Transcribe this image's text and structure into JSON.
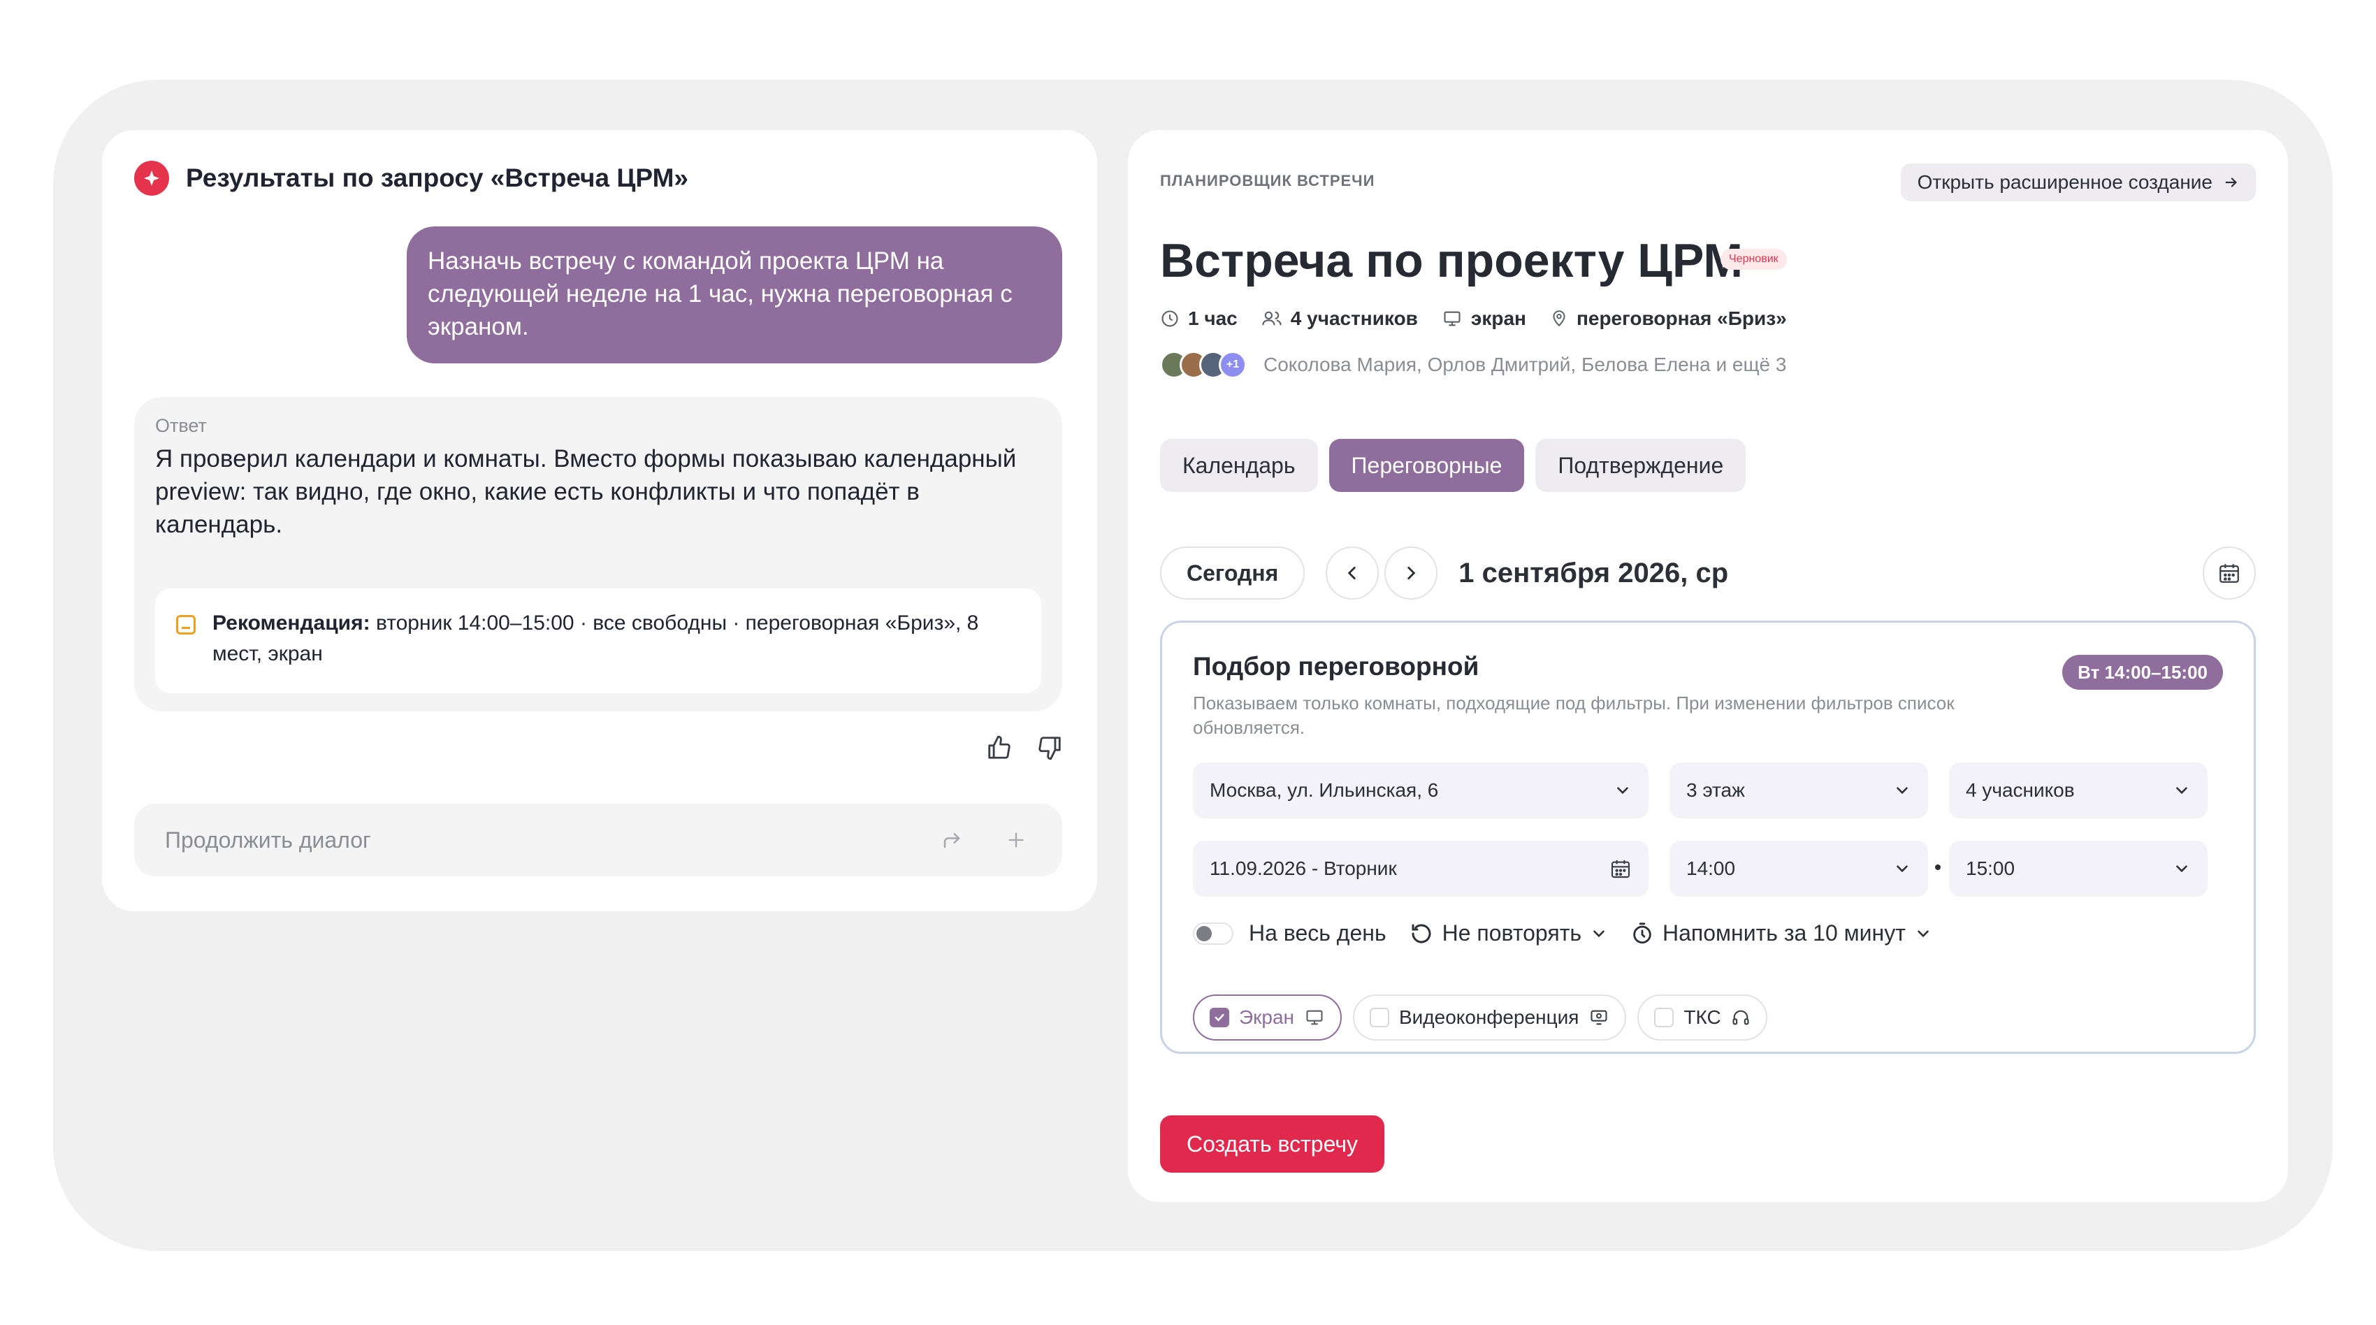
{
  "chat": {
    "title": "Результаты по запросу «Встреча ЦРМ»",
    "user_message": "Назначь встречу с командой проекта ЦРМ на следующей неделе на 1 час, нужна переговорная с экраном.",
    "answer_label": "Ответ",
    "answer_text": "Я проверил календари и комнаты. Вместо формы показываю календарный preview: так видно, где окно, какие есть конфликты и что попадёт в календарь.",
    "recommendation_label": "Рекомендация:",
    "recommendation_text": " вторник 14:00–15:00 · все свободны · переговорная «Бриз», 8 мест, экран",
    "continue_placeholder": "Продолжить диалог"
  },
  "planner": {
    "section_label": "ПЛАНИРОВЩИК ВСТРЕЧИ",
    "advanced_button": "Открыть расширенное создание",
    "title": "Встреча по проекту ЦРМ",
    "draft_badge": "Черновик",
    "meta": {
      "duration": "1 час",
      "participants_count": "4 участников",
      "equipment": "экран",
      "room": "переговорная «Бриз»"
    },
    "avatar_more": "+1",
    "participants_text": "Соколова Мария, Орлов Дмитрий, Белова Елена и ещё 3",
    "tabs": [
      "Календарь",
      "Переговорные",
      "Подтверждение"
    ],
    "active_tab": "Переговорные",
    "today_button": "Сегодня",
    "current_date": "1 сентября 2026, ср",
    "room_picker": {
      "title": "Подбор переговорной",
      "description": "Показываем только комнаты, подходящие под фильтры. При изменении фильтров список обновляется.",
      "time_badge": "Вт 14:00–15:00",
      "location": "Москва, ул. Ильинская, 6",
      "floor": "3 этаж",
      "capacity": "4 учасников",
      "date": "11.09.2026 - Вторник",
      "time_from": "14:00",
      "time_to": "15:00",
      "all_day": "На весь день",
      "repeat": "Не повторять",
      "reminder": "Напомнить за 10 минут",
      "features": [
        {
          "label": "Экран",
          "checked": true
        },
        {
          "label": "Видеоконференция",
          "checked": false
        },
        {
          "label": "ТКС",
          "checked": false
        }
      ]
    },
    "create_button": "Создать встречу"
  },
  "colors": {
    "accent": "#8f6d9d",
    "brand_red": "#e0294d",
    "panel_bg": "#f0f0f0"
  }
}
